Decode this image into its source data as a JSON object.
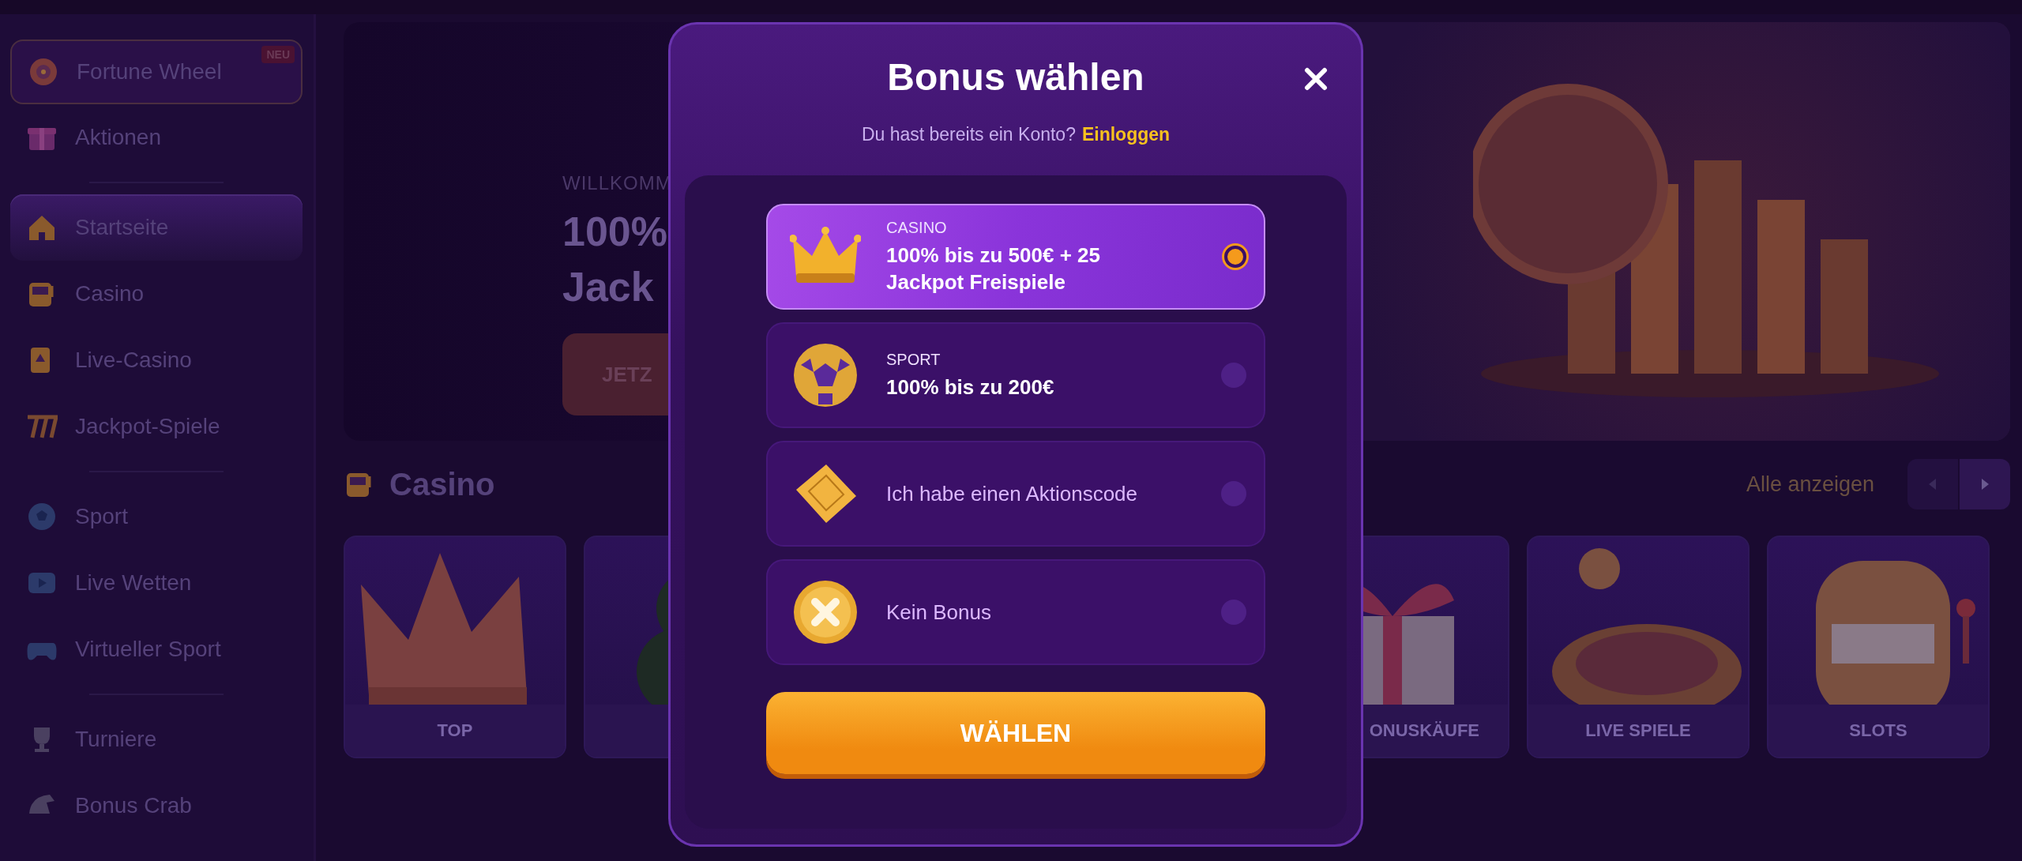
{
  "sidebar": {
    "groups": [
      [
        {
          "label": "Fortune Wheel",
          "badge": "NEU",
          "kind": "featured",
          "selected": false
        },
        {
          "label": "Aktionen",
          "kind": "plain",
          "selected": false
        }
      ],
      [
        {
          "label": "Startseite",
          "kind": "plain",
          "selected": true
        },
        {
          "label": "Casino",
          "kind": "plain",
          "selected": false
        },
        {
          "label": "Live-Casino",
          "kind": "plain",
          "selected": false
        },
        {
          "label": "Jackpot-Spiele",
          "kind": "plain",
          "selected": false
        }
      ],
      [
        {
          "label": "Sport",
          "kind": "plain",
          "selected": false
        },
        {
          "label": "Live Wetten",
          "kind": "plain",
          "selected": false
        },
        {
          "label": "Virtueller Sport",
          "kind": "plain",
          "selected": false
        }
      ],
      [
        {
          "label": "Turniere",
          "kind": "plain",
          "selected": false
        },
        {
          "label": "Bonus Crab",
          "kind": "plain",
          "selected": false
        }
      ]
    ]
  },
  "hero": {
    "eyebrow": "WILLKOMM",
    "headline": [
      "100%",
      "Jack"
    ],
    "button": "JETZ"
  },
  "section": {
    "title": "Casino",
    "link": "Alle anzeigen",
    "nav": [
      {
        "kind": "prev",
        "disabled": true
      },
      {
        "kind": "next",
        "disabled": false
      }
    ]
  },
  "cards": [
    {
      "kind": "crown",
      "label": "TOP"
    },
    {
      "kind": "clover"
    },
    {
      "kind": "gift",
      "label": "ONUSKÄUFE"
    },
    {
      "kind": "roulette",
      "label": "LIVE SPIELE"
    },
    {
      "kind": "slot",
      "label": "SLOTS"
    }
  ],
  "modal": {
    "title": "Bonus wählen",
    "subtitle": "Du hast bereits ein Konto?",
    "login_link": "Einloggen",
    "options": [
      {
        "kind": "crown",
        "category": "CASINO",
        "text": "100% bis zu 500€ + 25 Jackpot Freispiele",
        "selected": true
      },
      {
        "kind": "ball",
        "category": "SPORT",
        "text": "100% bis zu 200€",
        "selected": false
      },
      {
        "kind": "ticket",
        "text": "Ich habe einen Aktionscode",
        "selected": false
      },
      {
        "kind": "coin",
        "text": "Kein Bonus",
        "selected": false
      }
    ],
    "button": "WÄHLEN"
  }
}
